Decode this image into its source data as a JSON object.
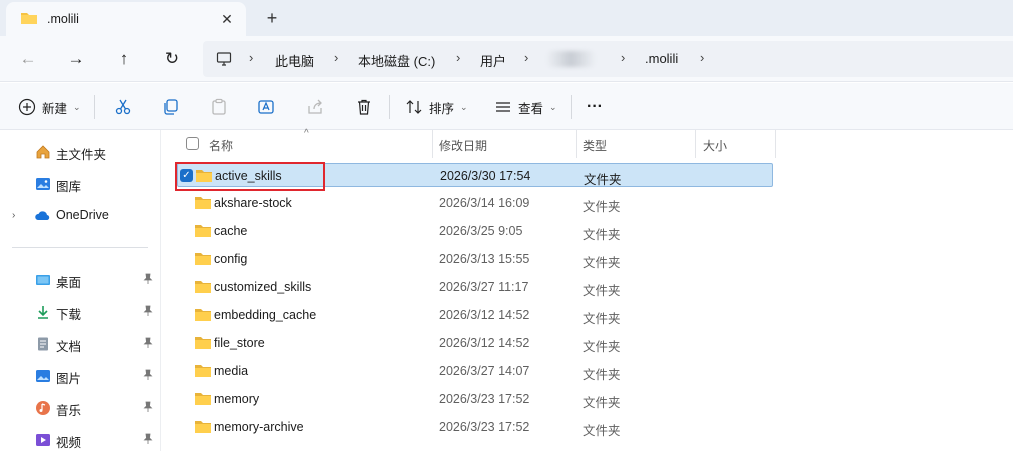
{
  "tab": {
    "title": ".molili",
    "close_glyph": "✕",
    "new_tab_glyph": "+"
  },
  "nav": {
    "back_glyph": "←",
    "forward_glyph": "→",
    "up_glyph": "↑",
    "refresh_glyph": "↻",
    "breadcrumbs": [
      "此电脑",
      "本地磁盘 (C:)",
      "用户",
      ".molili"
    ],
    "separator": "›"
  },
  "commands": {
    "new_label": "新建",
    "sort_label": "排序",
    "view_label": "查看",
    "more_glyph": "···"
  },
  "sidebar": {
    "items": [
      {
        "label": "主文件夹",
        "icon": "home-icon"
      },
      {
        "label": "图库",
        "icon": "gallery-icon"
      },
      {
        "label": "OneDrive",
        "icon": "onedrive-icon"
      },
      {
        "label": "桌面",
        "icon": "desktop-icon",
        "pinned": true
      },
      {
        "label": "下载",
        "icon": "download-icon",
        "pinned": true
      },
      {
        "label": "文档",
        "icon": "document-icon",
        "pinned": true
      },
      {
        "label": "图片",
        "icon": "pictures-icon",
        "pinned": true
      },
      {
        "label": "音乐",
        "icon": "music-icon",
        "pinned": true
      },
      {
        "label": "视频",
        "icon": "video-icon",
        "pinned": true
      }
    ],
    "expander_glyph": "›"
  },
  "list": {
    "columns": {
      "name": "名称",
      "modified": "修改日期",
      "type": "类型",
      "size": "大小"
    },
    "rows": [
      {
        "name": "active_skills",
        "modified": "2026/3/30 17:54",
        "type": "文件夹",
        "selected": true
      },
      {
        "name": "akshare-stock",
        "modified": "2026/3/14 16:09",
        "type": "文件夹"
      },
      {
        "name": "cache",
        "modified": "2026/3/25 9:05",
        "type": "文件夹"
      },
      {
        "name": "config",
        "modified": "2026/3/13 15:55",
        "type": "文件夹"
      },
      {
        "name": "customized_skills",
        "modified": "2026/3/27 11:17",
        "type": "文件夹"
      },
      {
        "name": "embedding_cache",
        "modified": "2026/3/12 14:52",
        "type": "文件夹"
      },
      {
        "name": "file_store",
        "modified": "2026/3/12 14:52",
        "type": "文件夹"
      },
      {
        "name": "media",
        "modified": "2026/3/27 14:07",
        "type": "文件夹"
      },
      {
        "name": "memory",
        "modified": "2026/3/23 17:52",
        "type": "文件夹"
      },
      {
        "name": "memory-archive",
        "modified": "2026/3/23 17:52",
        "type": "文件夹"
      }
    ]
  },
  "colors": {
    "folder": "#f6c343",
    "selection": "#cce4f7",
    "accent": "#1a6fc9",
    "highlight_box": "#e0272e"
  }
}
